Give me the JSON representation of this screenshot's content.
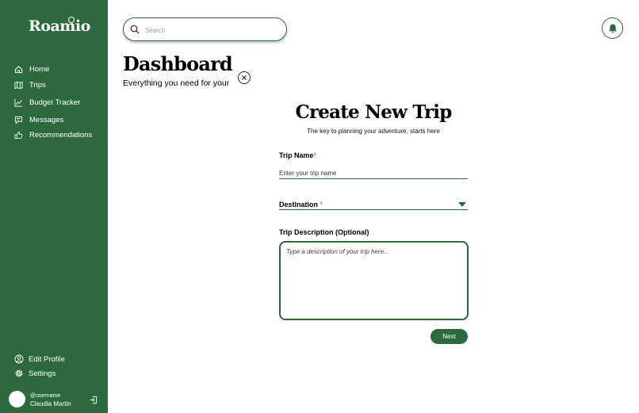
{
  "app": {
    "name": "Roamio"
  },
  "sidebar": {
    "items": [
      {
        "label": "Home",
        "icon": "home-icon"
      },
      {
        "label": "Trips",
        "icon": "map-icon"
      },
      {
        "label": "Budget Tracker",
        "icon": "chart-line-icon"
      },
      {
        "label": "Messages",
        "icon": "message-icon"
      },
      {
        "label": "Recommendations",
        "icon": "thumbs-up-icon"
      }
    ],
    "bottom": [
      {
        "label": "Edit Profile",
        "icon": "user-circle-icon"
      },
      {
        "label": "Settings",
        "icon": "gear-icon"
      }
    ],
    "user": {
      "handle": "@username",
      "name": "Claudia Martin"
    }
  },
  "header": {
    "search_placeholder": "Search"
  },
  "dashboard": {
    "title": "Dashboard",
    "subtitle": "Everything you need for your next adventure"
  },
  "modal": {
    "title": "Create New Trip",
    "subtitle": "The key to planning your adventure, starts here",
    "trip_name": {
      "label": "Trip Name",
      "required_mark": "*",
      "placeholder": "Enter your trip name"
    },
    "destination": {
      "label": "Destination",
      "required_mark": "*"
    },
    "description": {
      "label": "Trip Description  (Optional)",
      "placeholder": "Type a description of your trip here..."
    },
    "next_label": "Next"
  },
  "colors": {
    "brand": "#2c6a3e",
    "required": "#c0392b"
  }
}
